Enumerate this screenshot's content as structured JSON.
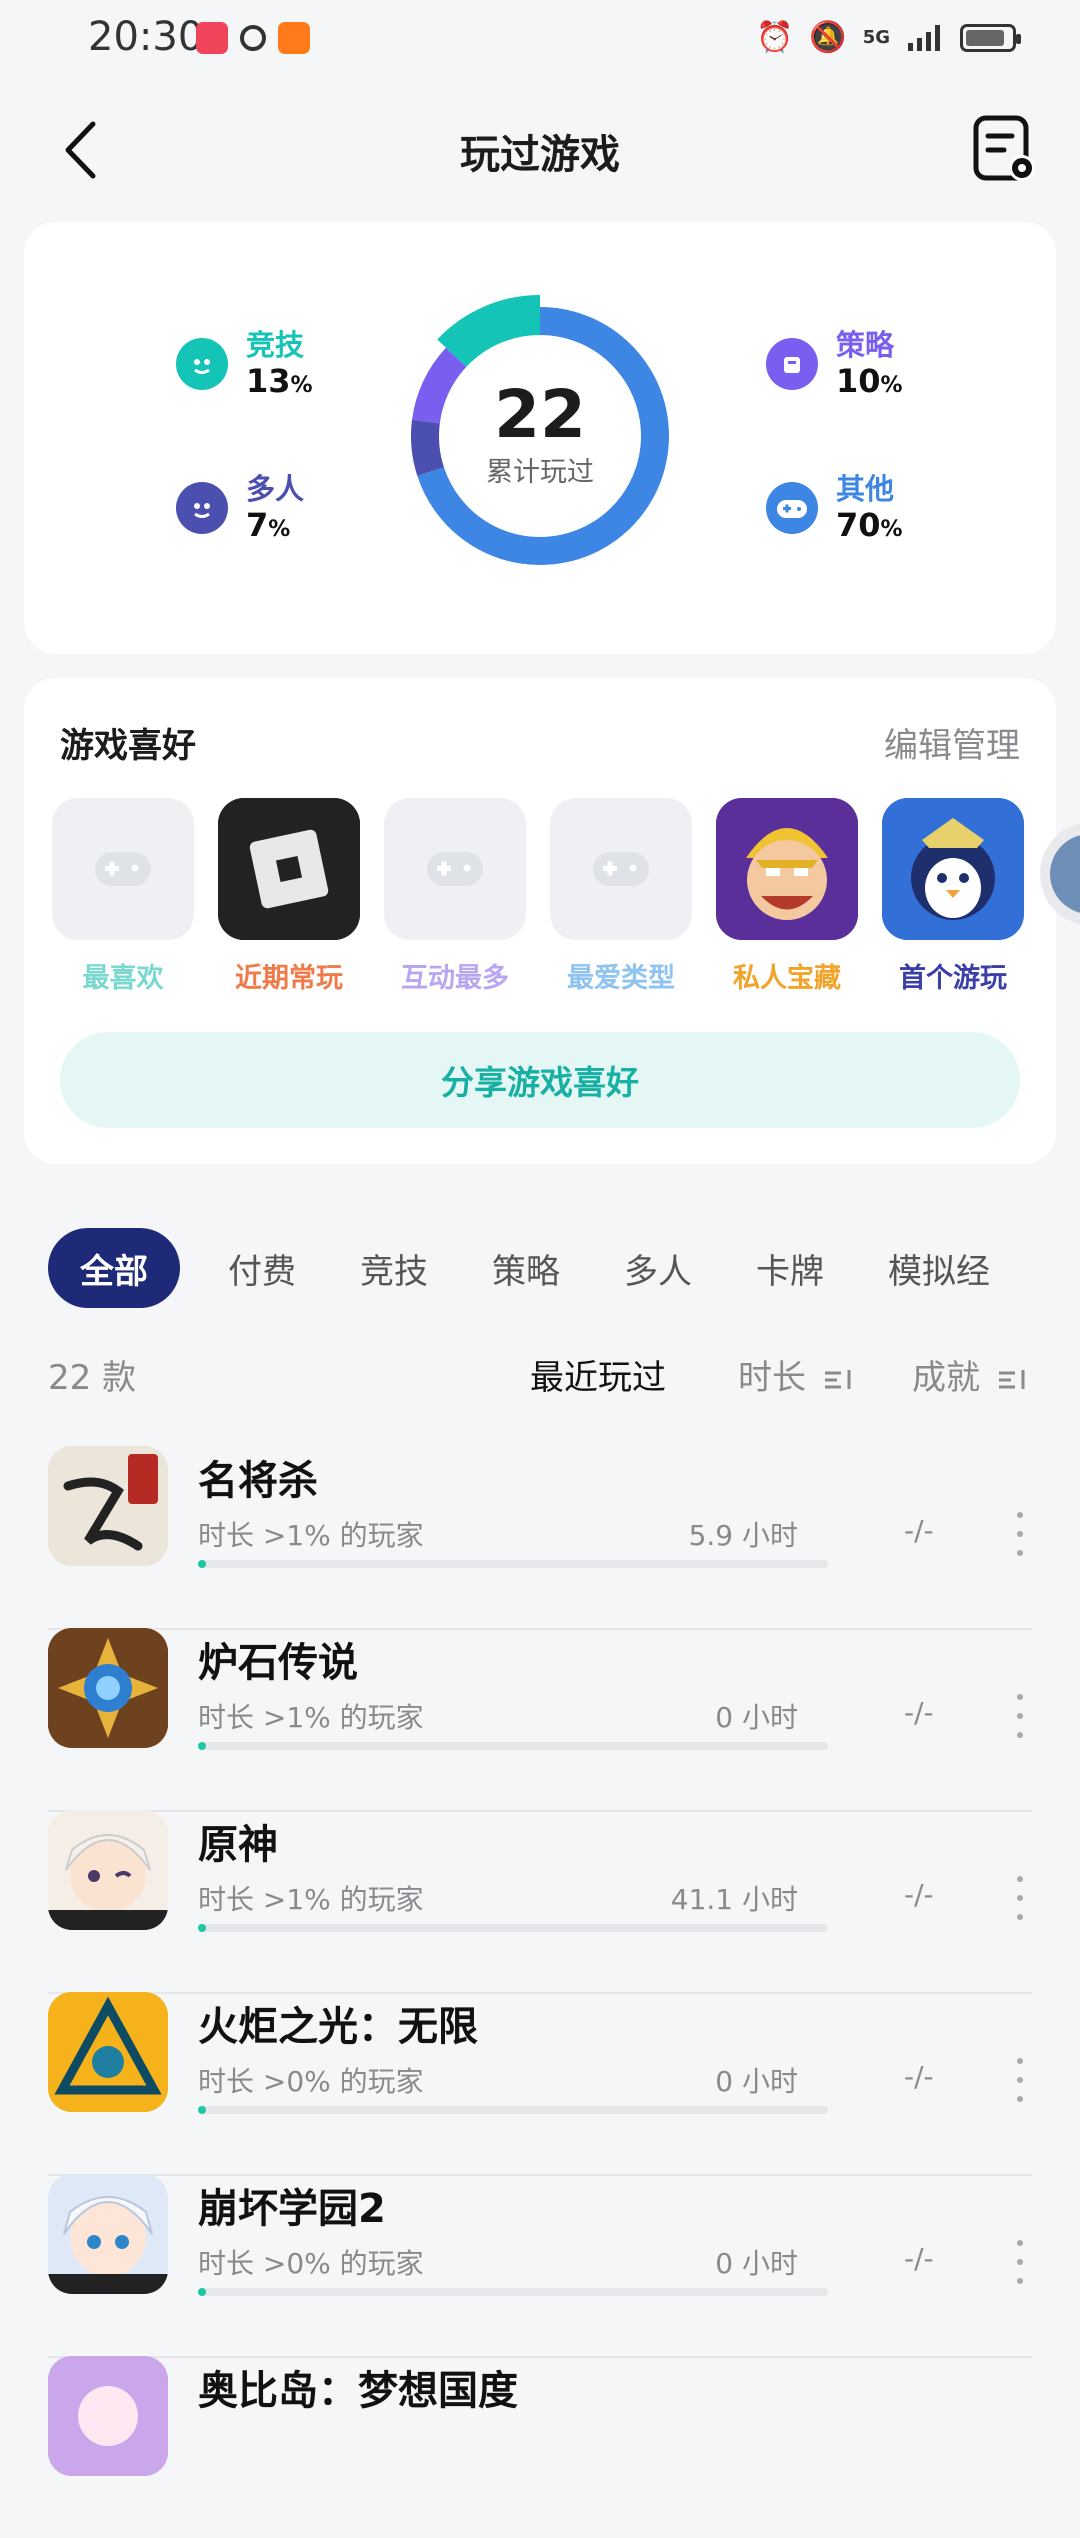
{
  "status": {
    "time": "20:30",
    "network": "5G"
  },
  "header": {
    "title": "玩过游戏"
  },
  "stats": {
    "total": "22",
    "total_label": "累计玩过",
    "categories": [
      {
        "name": "竞技",
        "pct": "13",
        "unit": "%",
        "color": "#14c4b6"
      },
      {
        "name": "多人",
        "pct": "7",
        "unit": "%",
        "color": "#4a4fb0"
      },
      {
        "name": "策略",
        "pct": "10",
        "unit": "%",
        "color": "#7a5ef0"
      },
      {
        "name": "其他",
        "pct": "70",
        "unit": "%",
        "color": "#3d86e3"
      }
    ]
  },
  "prefs": {
    "title": "游戏喜好",
    "edit": "编辑管理",
    "items": [
      {
        "label": "最喜欢",
        "color": "#7ad9cf"
      },
      {
        "label": "近期常玩",
        "color": "#f07a4a"
      },
      {
        "label": "互动最多",
        "color": "#b9a5f0"
      },
      {
        "label": "最爱类型",
        "color": "#8fc3f0"
      },
      {
        "label": "私人宝藏",
        "color": "#f0a52a"
      },
      {
        "label": "首个游玩",
        "color": "#3b3fa8"
      }
    ],
    "share": "分享游戏喜好"
  },
  "tabs": [
    "全部",
    "付费",
    "竞技",
    "策略",
    "多人",
    "卡牌",
    "模拟经"
  ],
  "list": {
    "count": "22 款",
    "sort_recent": "最近玩过",
    "sort_duration": "时长",
    "sort_achievement": "成就",
    "games": [
      {
        "name": "名将杀",
        "sub": "时长 >1% 的玩家",
        "hours": "5.9 小时",
        "ach": "-/-"
      },
      {
        "name": "炉石传说",
        "sub": "时长 >1% 的玩家",
        "hours": "0 小时",
        "ach": "-/-"
      },
      {
        "name": "原神",
        "sub": "时长 >1% 的玩家",
        "hours": "41.1 小时",
        "ach": "-/-"
      },
      {
        "name": "火炬之光：无限",
        "sub": "时长 >0% 的玩家",
        "hours": "0 小时",
        "ach": "-/-"
      },
      {
        "name": "崩坏学园2",
        "sub": "时长 >0% 的玩家",
        "hours": "0 小时",
        "ach": "-/-"
      },
      {
        "name": "奥比岛：梦想国度",
        "sub": "",
        "hours": "",
        "ach": ""
      }
    ]
  }
}
